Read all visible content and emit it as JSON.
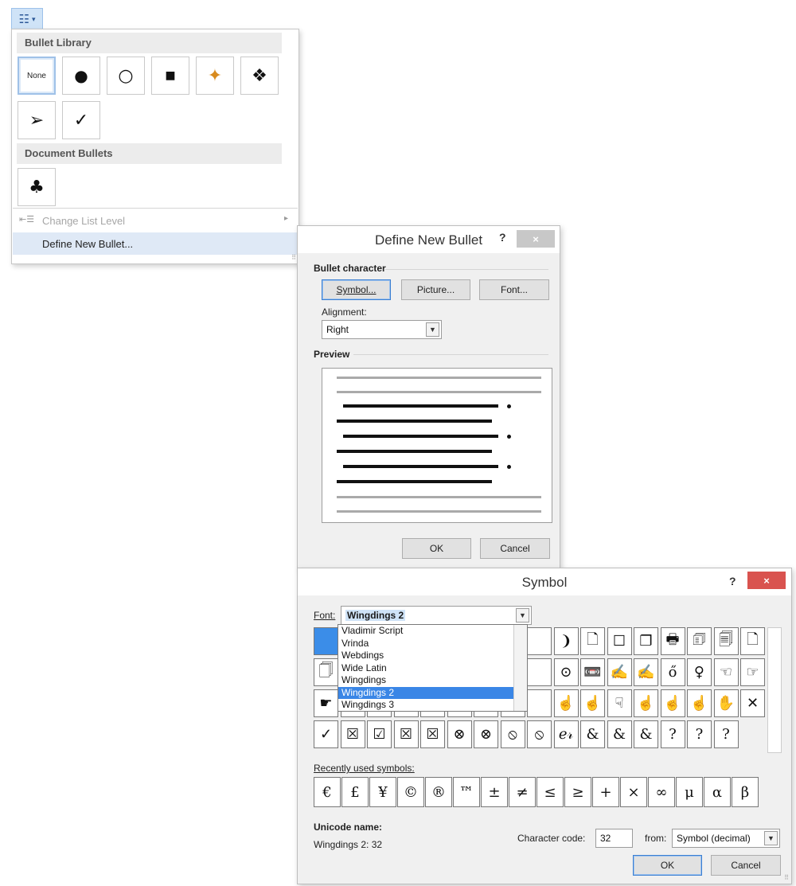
{
  "bullet_menu": {
    "library_title": "Bullet Library",
    "library_items": [
      {
        "label": "None",
        "glyph": ""
      },
      {
        "label": "",
        "glyph": "●"
      },
      {
        "label": "",
        "glyph": "○"
      },
      {
        "label": "",
        "glyph": "■"
      },
      {
        "label": "",
        "glyph": "✦"
      },
      {
        "label": "",
        "glyph": "❖"
      },
      {
        "label": "",
        "glyph": "➢"
      },
      {
        "label": "",
        "glyph": "✓"
      }
    ],
    "document_title": "Document Bullets",
    "document_items": [
      {
        "glyph": "♣"
      }
    ],
    "change_level": "Change List Level",
    "define_new": "Define New Bullet..."
  },
  "define_dialog": {
    "title": "Define New Bullet",
    "help": "?",
    "close": "×",
    "bullet_character_label": "Bullet character",
    "symbol_button": "Symbol...",
    "picture_button": "Picture...",
    "font_button": "Font...",
    "alignment_label": "Alignment:",
    "alignment_value": "Right",
    "preview_label": "Preview",
    "ok": "OK",
    "cancel": "Cancel"
  },
  "symbol_dialog": {
    "title": "Symbol",
    "help": "?",
    "close": "×",
    "font_label": "Font:",
    "font_value": "Wingdings 2",
    "font_options": [
      "Vladimir Script",
      "Vrinda",
      "Webdings",
      "Wide Latin",
      "Wingdings",
      "Wingdings 2",
      "Wingdings 3"
    ],
    "font_selected": "Wingdings 2",
    "grid_rows": [
      [
        "",
        "",
        "",
        "",
        "",
        "",
        "",
        "",
        "",
        "❩",
        "🗋",
        "☐",
        "❐",
        "🖶",
        "🗊",
        "🗐",
        "🗋"
      ],
      [
        "🗍",
        "",
        "",
        "",
        "",
        "",
        "",
        "",
        "",
        "⊙",
        "📼",
        "✍",
        "✍",
        "ő",
        "♀",
        "☜",
        "☞"
      ],
      [
        "☛",
        "",
        "",
        "",
        "",
        "",
        "",
        "",
        "",
        "☝",
        "☝",
        "☟",
        "☝",
        "☝",
        "☝",
        "✋",
        "✕"
      ],
      [
        "✓",
        "☒",
        "☑",
        "☒",
        "☒",
        "⊗",
        "⊗",
        "⦸",
        "⦸",
        "ℯ𝓇",
        "&",
        "&",
        "&",
        "?",
        "?",
        "?"
      ]
    ],
    "recent_label": "Recently used symbols:",
    "recent_symbols": [
      "€",
      "£",
      "¥",
      "©",
      "®",
      "™",
      "±",
      "≠",
      "≤",
      "≥",
      "+",
      "×",
      "∞",
      "μ",
      "α",
      "β"
    ],
    "unicode_label": "Unicode name:",
    "unicode_value": "Wingdings 2: 32",
    "char_code_label": "Character code:",
    "char_code_value": "32",
    "from_label": "from:",
    "from_value": "Symbol (decimal)",
    "ok": "OK",
    "cancel": "Cancel"
  },
  "colors": {
    "accent": "#3b8de8",
    "close_red": "#d9534f",
    "close_gray": "#c8c8c8"
  }
}
